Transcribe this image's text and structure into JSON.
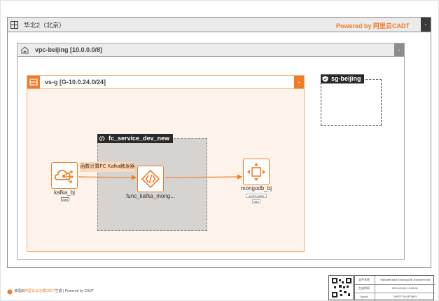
{
  "region": {
    "title": "华北2（北京）",
    "powered_by": "Powered by 阿里云CADT",
    "toggle": "-"
  },
  "vpc": {
    "title": "vpc-beijing [10.0.0.0/8]",
    "toggle": "-"
  },
  "vswitch": {
    "title": "vs-g [G-10.0.24.0/24]",
    "toggle": "-"
  },
  "security_group": {
    "title": "sg-beijing"
  },
  "fc_service": {
    "title": "fc_service_dev_new"
  },
  "nodes": {
    "kafka": {
      "label": "kafka_bj",
      "spec": "Mini"
    },
    "func": {
      "label": "func_kafka_mong..."
    },
    "mongo": {
      "label": "mongodb_bj",
      "spec": "4vCPU 8GB",
      "spec2": "Mini"
    }
  },
  "edges": {
    "trigger_label": "函数计算FC Kafka触发器"
  },
  "footer": {
    "prefix": "该图由",
    "brand": "阿里云云治理CADT",
    "suffix": "生成 | Powered by CADT"
  },
  "info_table": {
    "rows": [
      {
        "key": "文件名称",
        "value": "ValidateKafkaToMongoDB-fcdcsseechat"
      },
      {
        "key": "生成时间",
        "value": "2024-03-04 10:58:04"
      },
      {
        "key": "AppId",
        "value": "2N9TF7010FD5BY"
      }
    ]
  },
  "colors": {
    "accent": "#f07c28",
    "dark": "#2a2a2a",
    "grey_header": "#ebebeb",
    "vswitch_fill": "#fdf3ea",
    "service_fill": "#d6d3d0"
  },
  "icons": {
    "region": "grid-icon",
    "vpc": "cloud-house-icon",
    "vswitch": "switch-icon",
    "sg": "shield-icon",
    "fc": "function-icon",
    "kafka": "kafka-icon",
    "func": "fc-function-icon",
    "mongo": "mongodb-icon"
  }
}
